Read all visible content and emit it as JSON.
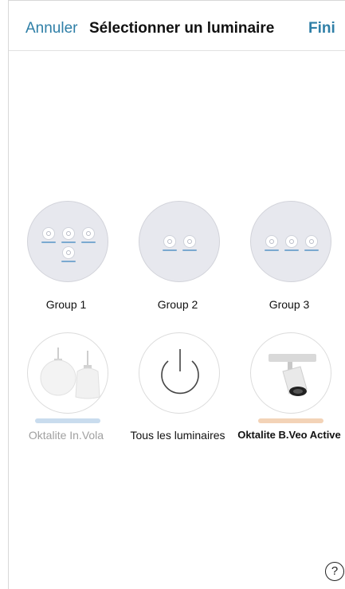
{
  "nav": {
    "cancel_label": "Annuler",
    "title": "Sélectionner un luminaire",
    "done_label": "Fini"
  },
  "tiles": [
    {
      "label": "Group 1",
      "kind": "group",
      "icon": "group-icon"
    },
    {
      "label": "Group 2",
      "kind": "group",
      "icon": "group-icon"
    },
    {
      "label": "Group 3",
      "kind": "group",
      "icon": "group-icon"
    },
    {
      "label": "Oktalite In.Vola",
      "kind": "luminaire",
      "icon": "pendant-lamps-icon",
      "stripe_color": "#c9dcee",
      "dimmed": true
    },
    {
      "label": "Tous les luminaires",
      "kind": "all",
      "icon": "power-icon"
    },
    {
      "label": "Oktalite B.Veo Active",
      "kind": "luminaire",
      "icon": "track-spotlight-icon",
      "stripe_color": "#f3d3b7"
    }
  ],
  "help": {
    "glyph": "?"
  },
  "colors": {
    "accent": "#2f7fa7",
    "group_bar": "#7aa9d0"
  }
}
